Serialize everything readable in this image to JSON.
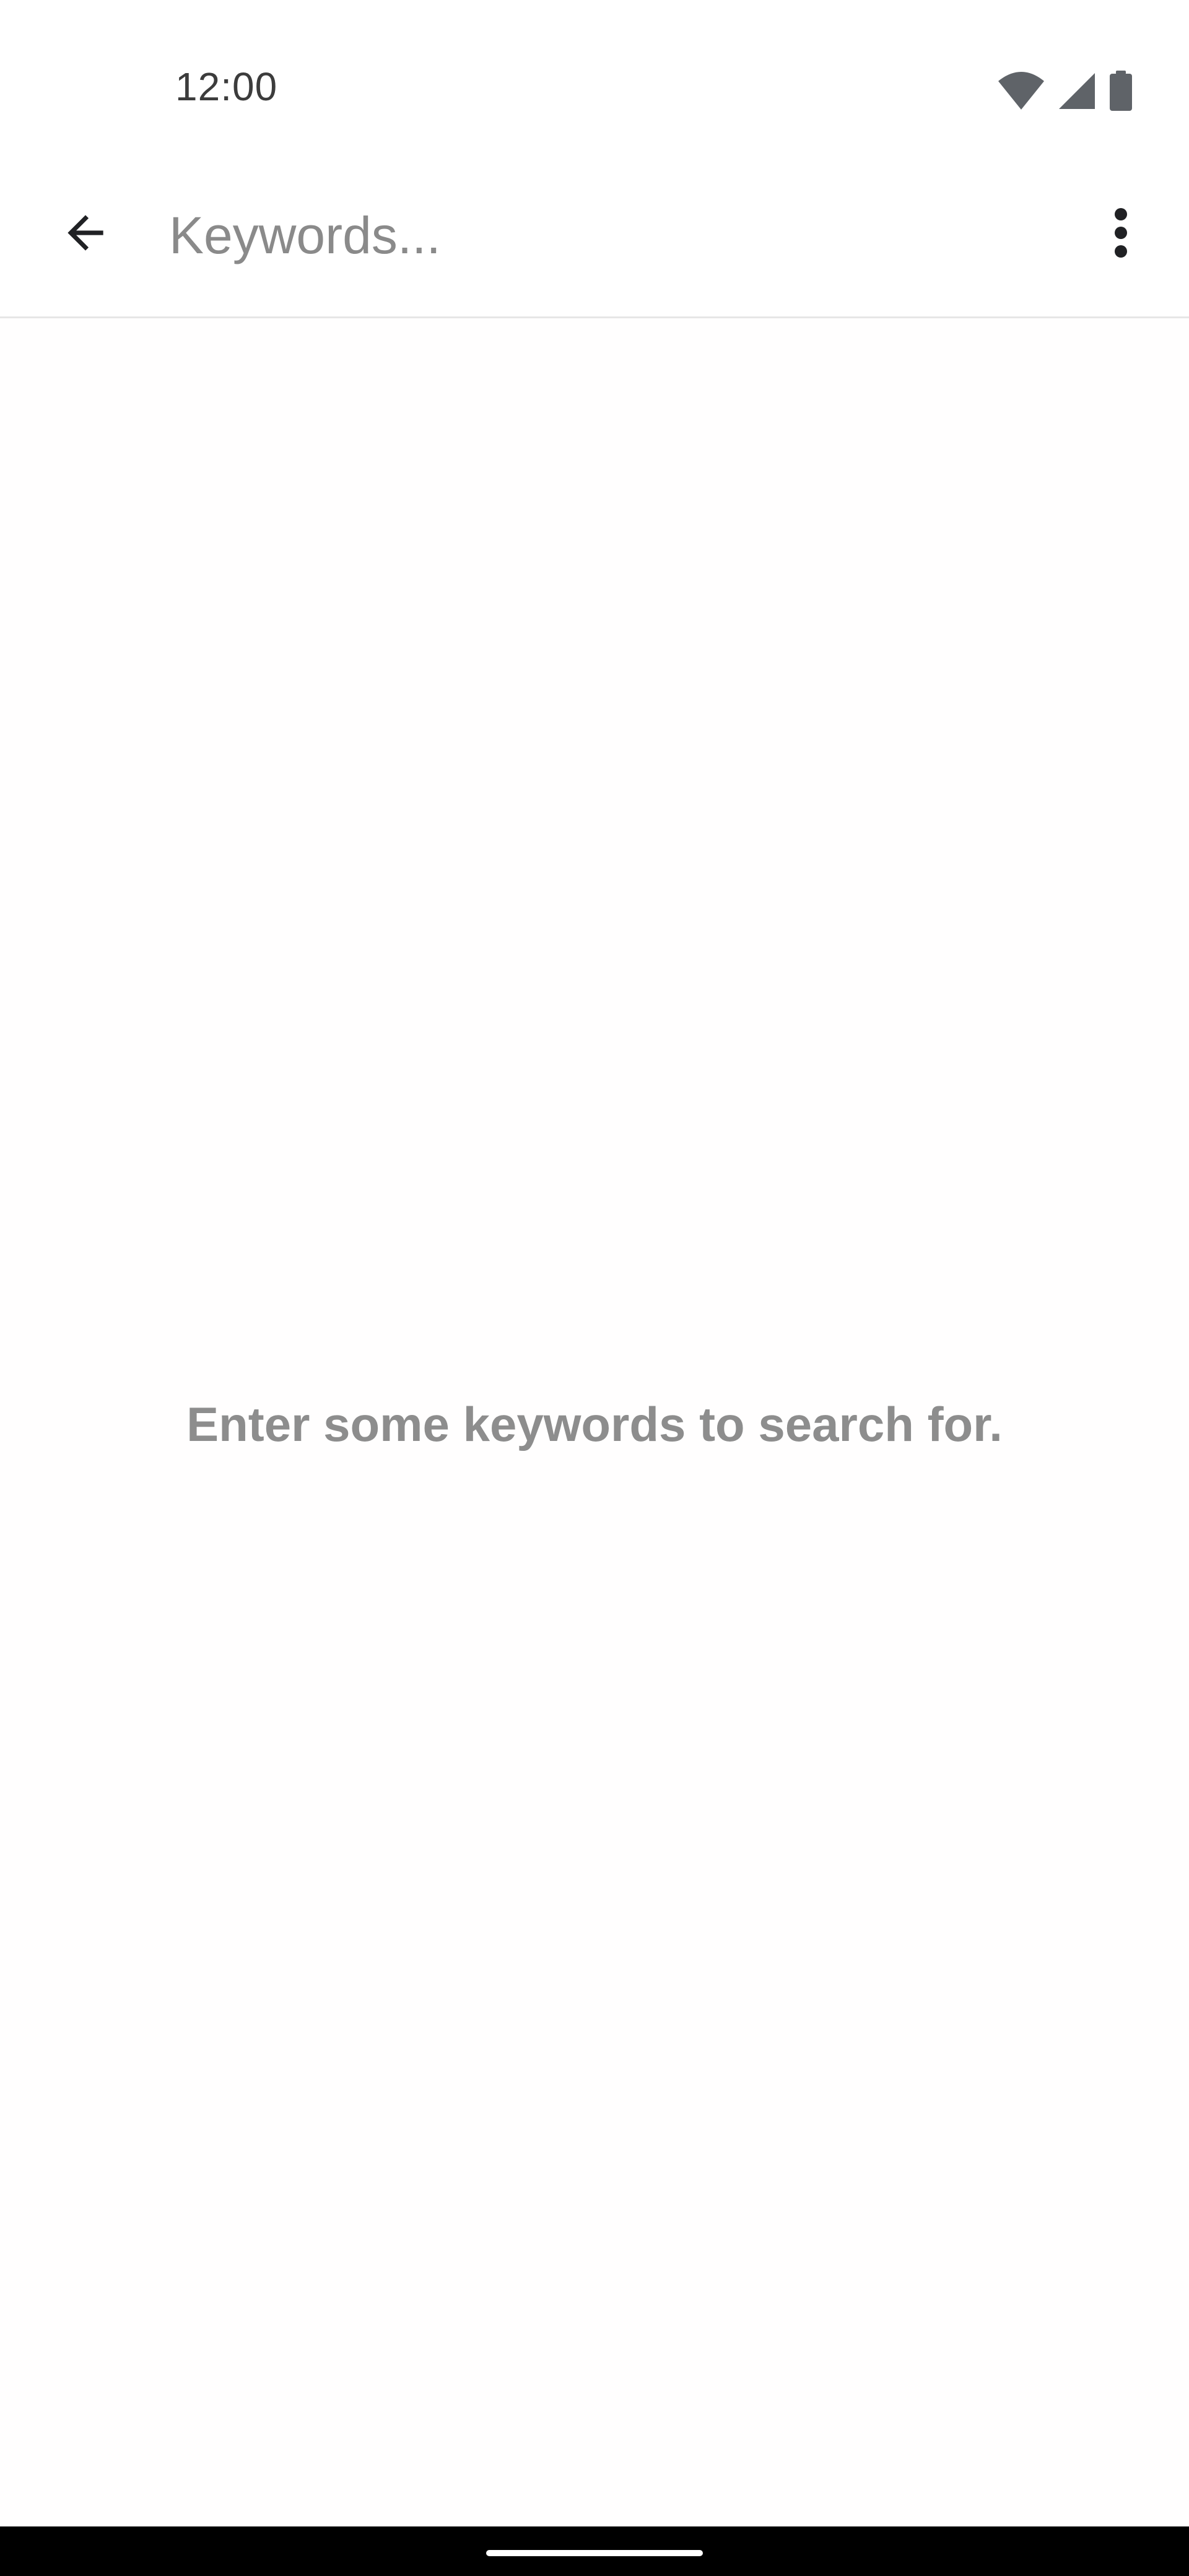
{
  "status_bar": {
    "time": "12:00",
    "icons": [
      "wifi-icon",
      "cellular-signal-icon",
      "battery-icon"
    ],
    "icon_color": "#5f6368"
  },
  "toolbar": {
    "back_icon": "arrow-back-icon",
    "search": {
      "placeholder": "Keywords...",
      "value": ""
    },
    "overflow_icon": "more-vert-icon"
  },
  "main": {
    "empty_state_message": "Enter some keywords to search for."
  },
  "colors": {
    "background": "#ffffff",
    "placeholder_text": "#8a8a8a",
    "empty_state_text": "#8d8d8d",
    "divider": "#e6e6e6",
    "nav_bar": "#000000"
  }
}
